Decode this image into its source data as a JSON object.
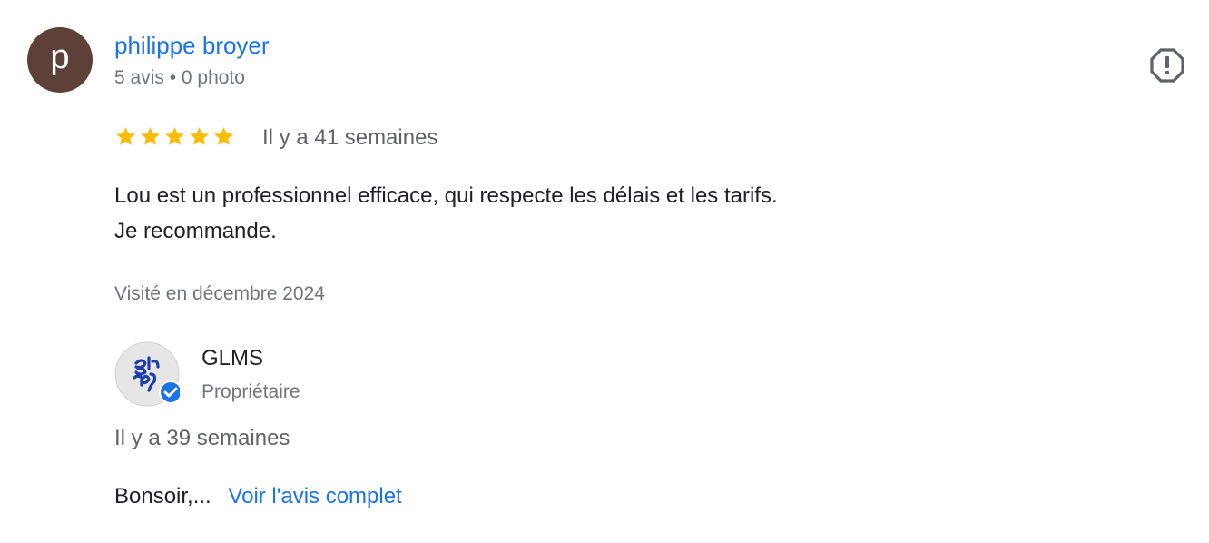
{
  "reviewer": {
    "initial": "p",
    "avatar_color": "#5d4037",
    "name": "philippe broyer",
    "meta": "5 avis • 0 photo"
  },
  "report_icon": "report-flag-icon",
  "review": {
    "rating": 5,
    "max_rating": 5,
    "star_color": "#fbbc04",
    "date": "Il y a 41 semaines",
    "text_lines": [
      "Lou est un professionnel efficace, qui respecte les délais et les tarifs.",
      "Je recommande."
    ],
    "visit": "Visité en décembre 2024"
  },
  "owner_response": {
    "name": "GLMS",
    "role": "Propriétaire",
    "verified_color": "#1a73e8",
    "date": "Il y a 39 semaines",
    "snippet": "Bonsoir,...",
    "see_more_label": "Voir l'avis complet"
  },
  "link_color": "#1a73e8"
}
